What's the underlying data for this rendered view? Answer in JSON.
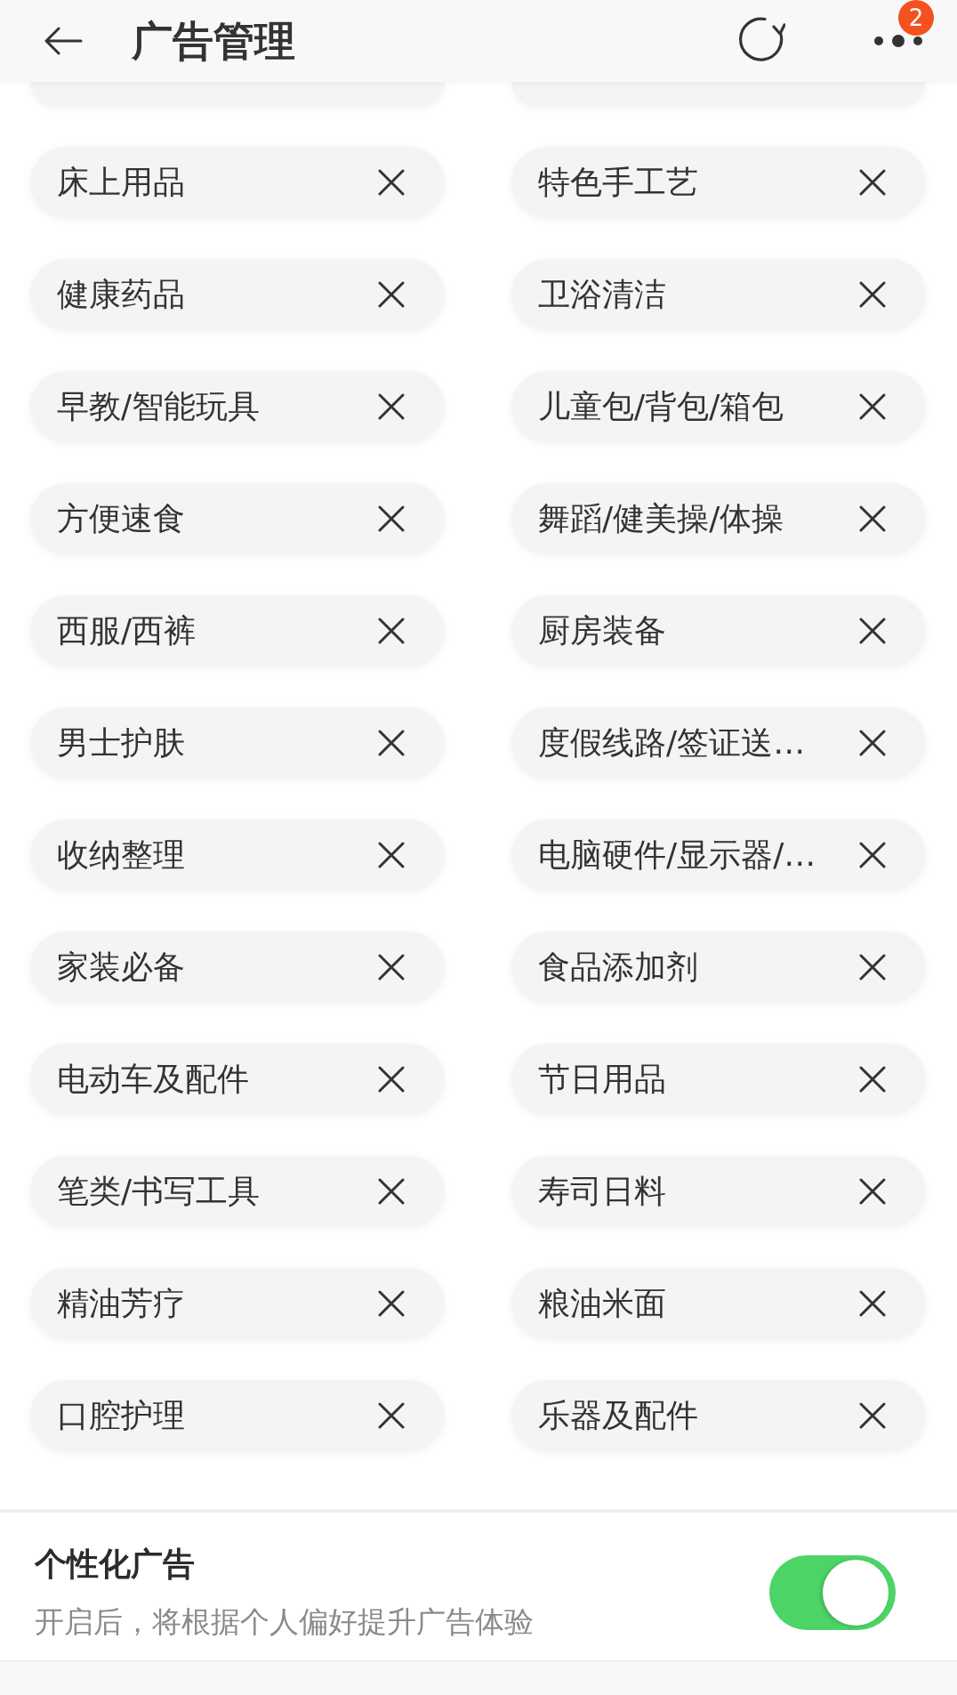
{
  "header": {
    "title": "广告管理",
    "badge": "2"
  },
  "tags": [
    {
      "label": "床上用品"
    },
    {
      "label": "特色手工艺"
    },
    {
      "label": "健康药品"
    },
    {
      "label": "卫浴清洁"
    },
    {
      "label": "早教/智能玩具"
    },
    {
      "label": "儿童包/背包/箱包"
    },
    {
      "label": "方便速食"
    },
    {
      "label": "舞蹈/健美操/体操"
    },
    {
      "label": "西服/西裤"
    },
    {
      "label": "厨房装备"
    },
    {
      "label": "男士护肤"
    },
    {
      "label": "度假线路/签证送…"
    },
    {
      "label": "收纳整理"
    },
    {
      "label": "电脑硬件/显示器/…"
    },
    {
      "label": "家装必备"
    },
    {
      "label": "食品添加剂"
    },
    {
      "label": "电动车及配件"
    },
    {
      "label": "节日用品"
    },
    {
      "label": "笔类/书写工具"
    },
    {
      "label": "寿司日料"
    },
    {
      "label": "精油芳疗"
    },
    {
      "label": "粮油米面"
    },
    {
      "label": "口腔护理"
    },
    {
      "label": "乐器及配件"
    }
  ],
  "setting": {
    "title": "个性化广告",
    "description": "开启后，将根据个人偏好提升广告体验",
    "on": true
  }
}
